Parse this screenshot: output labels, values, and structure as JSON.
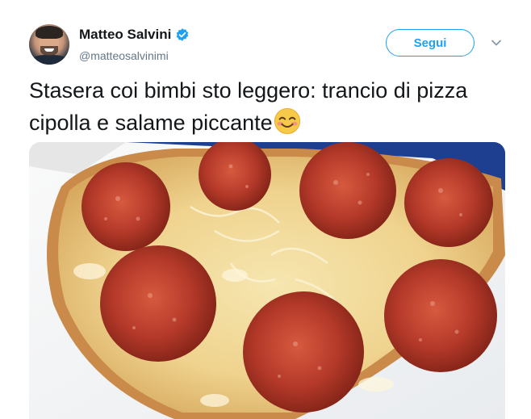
{
  "author": {
    "name": "Matteo Salvini",
    "handle": "@matteosalvinimi",
    "verified": true
  },
  "actions": {
    "follow_label": "Segui"
  },
  "tweet": {
    "text": "Stasera coi bimbi sto leggero: trancio di pizza cipolla e salame piccante"
  },
  "icons": {
    "verified": "verified-badge-icon",
    "menu": "chevron-down-icon",
    "emoji": "smiling-face-with-smiling-eyes-emoji"
  },
  "colors": {
    "accent": "#1da1f2",
    "text": "#14171a",
    "secondary": "#657786"
  }
}
